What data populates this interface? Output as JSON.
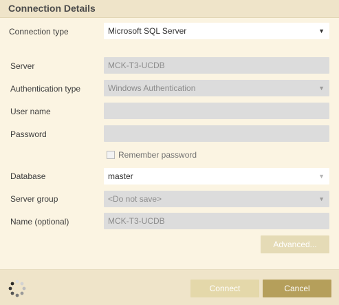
{
  "header": {
    "title": "Connection Details"
  },
  "form": {
    "connection_type": {
      "label": "Connection type",
      "value": "Microsoft SQL Server"
    },
    "server": {
      "label": "Server",
      "value": "MCK-T3-UCDB"
    },
    "authentication_type": {
      "label": "Authentication type",
      "value": "Windows Authentication"
    },
    "user_name": {
      "label": "User name",
      "value": ""
    },
    "password": {
      "label": "Password",
      "value": ""
    },
    "remember_password": {
      "label": "Remember password",
      "checked": false
    },
    "database": {
      "label": "Database",
      "value": "master"
    },
    "server_group": {
      "label": "Server group",
      "value": "<Do not save>"
    },
    "name": {
      "label": "Name (optional)",
      "value": "MCK-T3-UCDB"
    }
  },
  "buttons": {
    "advanced": "Advanced...",
    "connect": "Connect",
    "cancel": "Cancel"
  },
  "icons": {
    "dropdown": "▼",
    "spinner": "loading-spinner-icon"
  },
  "colors": {
    "background": "#fbf4e2",
    "header": "#efe4c9",
    "accent": "#b59f5b",
    "disabled_button": "#e4d8aa",
    "disabled_field": "#dcdcdc"
  }
}
